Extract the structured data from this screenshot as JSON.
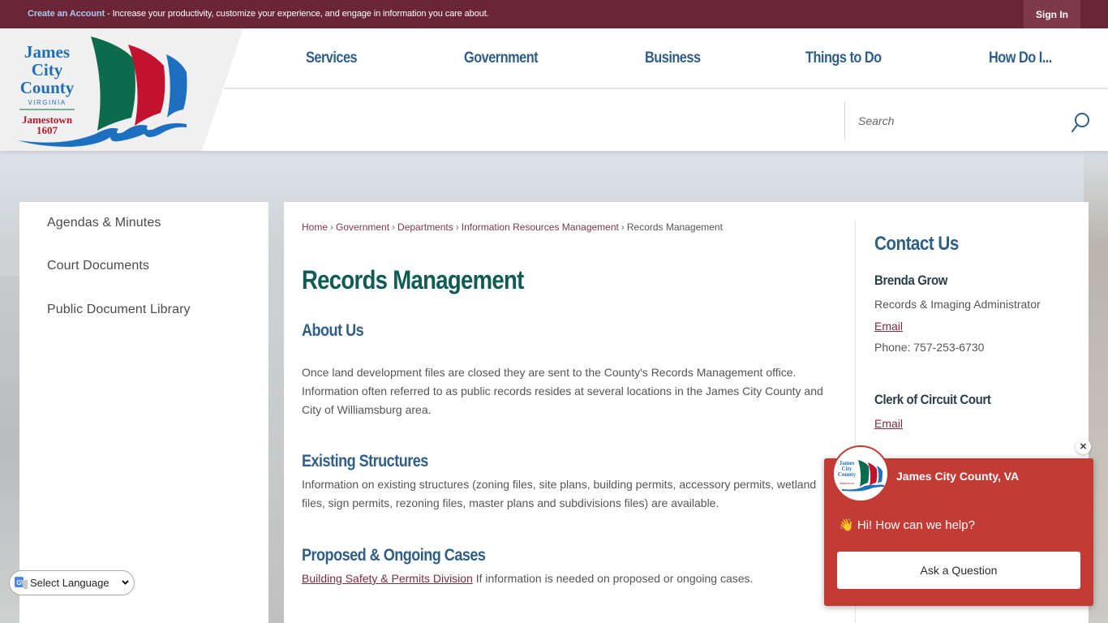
{
  "topbar": {
    "promo_link": "Create an Account",
    "promo_text": " - Increase your productivity, customize your experience, and engage in information you care about.",
    "signin_label": "Sign In"
  },
  "logo": {
    "line1": "James",
    "line2": "City",
    "line3": "County",
    "line4": "VIRGINIA",
    "line5": "Jamestown",
    "line6": "1607"
  },
  "nav": {
    "items": [
      {
        "label": "Services"
      },
      {
        "label": "Government"
      },
      {
        "label": "Business"
      },
      {
        "label": "Things to Do"
      },
      {
        "label": "How Do I..."
      }
    ]
  },
  "search": {
    "placeholder": "Search",
    "value": ""
  },
  "sidebar": {
    "items": [
      {
        "label": "Agendas & Minutes"
      },
      {
        "label": "Court Documents"
      },
      {
        "label": "Public Document Library"
      }
    ]
  },
  "breadcrumb": {
    "items": [
      {
        "label": "Home"
      },
      {
        "label": "Government"
      },
      {
        "label": "Departments"
      },
      {
        "label": "Information Resources Management"
      }
    ],
    "current": "Records Management",
    "separator": "›"
  },
  "main": {
    "title": "Records Management",
    "sections": [
      {
        "heading": "About Us",
        "text": "Once land development files are closed they are sent to the County's Records Management office. Information often referred to as public records resides at several locations in the James City County and City of Williamsburg area."
      },
      {
        "heading": "Existing Structures",
        "text": "Information on existing structures (zoning files, site plans, building permits, accessory permits, wetland files, sign permits, rezoning files, master plans and subdivisions files) are available."
      },
      {
        "heading": "Proposed & Ongoing Cases",
        "link": "Building Safety & Permits Division",
        "text": " If information is needed on proposed or ongoing cases."
      }
    ]
  },
  "contact": {
    "title": "Contact Us",
    "people": [
      {
        "name": "Brenda Grow",
        "role": "Records & Imaging Administrator",
        "email_label": "Email",
        "phone": "Phone: 757-253-6730"
      },
      {
        "name": "Clerk of Circuit Court",
        "email_label": "Email"
      }
    ]
  },
  "chat": {
    "title": "James City County, VA",
    "greeting_emoji": "👋",
    "greeting": "Hi! How can we help?",
    "button_label": "Ask a Question",
    "close_icon": "✕"
  },
  "language": {
    "selected": "Select Language"
  },
  "colors": {
    "topbar": "#6b2536",
    "nav_text": "#2f5f88",
    "title_green": "#0f5c54",
    "link_maroon": "#7a2c3e",
    "chat_red": "#c33b35"
  }
}
